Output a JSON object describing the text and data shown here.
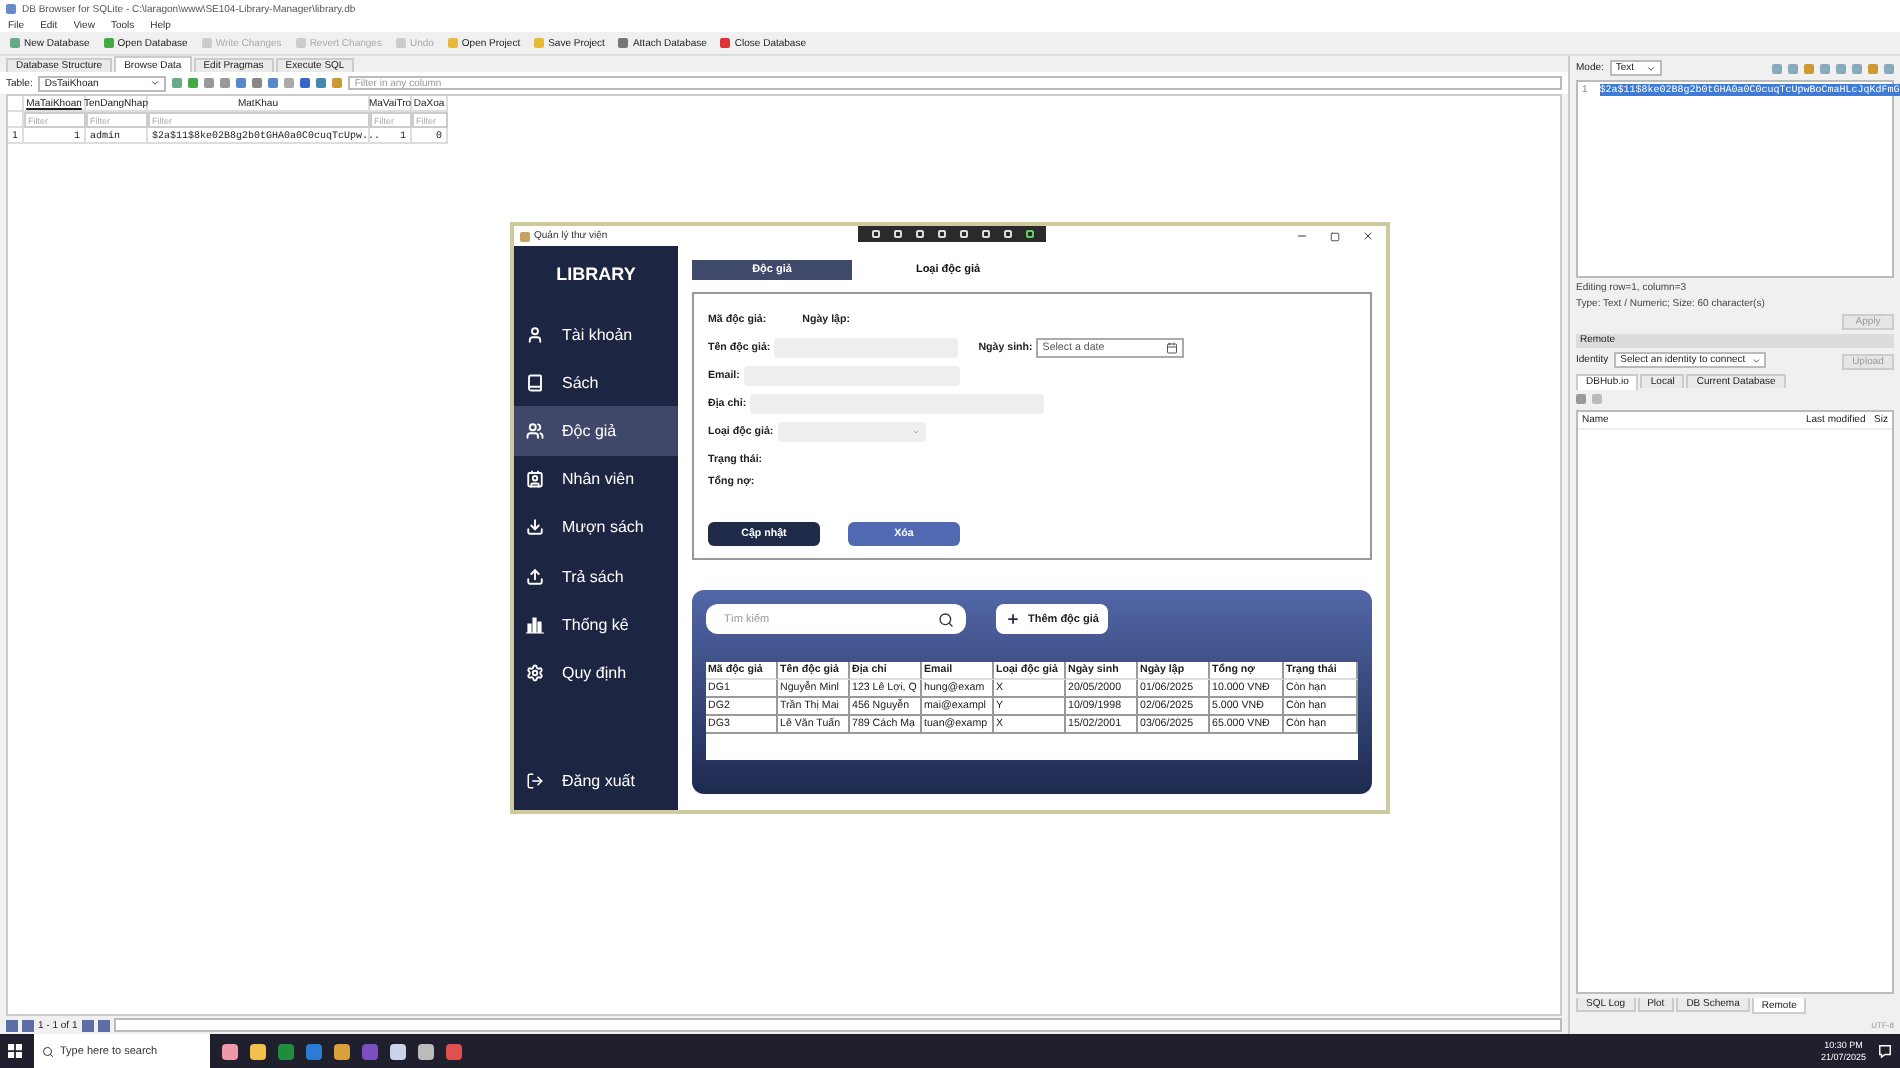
{
  "dbb": {
    "title": "DB Browser for SQLite - C:\\laragon\\www\\SE104-Library-Manager\\library.db",
    "menu": [
      "File",
      "Edit",
      "View",
      "Tools",
      "Help"
    ],
    "toolbar": [
      {
        "label": "New Database",
        "disabled": false
      },
      {
        "label": "Open Database",
        "disabled": false
      },
      {
        "label": "Write Changes",
        "disabled": true
      },
      {
        "label": "Revert Changes",
        "disabled": true
      },
      {
        "label": "Undo",
        "disabled": true
      },
      {
        "label": "Open Project",
        "disabled": false
      },
      {
        "label": "Save Project",
        "disabled": false
      },
      {
        "label": "Attach Database",
        "disabled": false
      },
      {
        "label": "Close Database",
        "disabled": false
      }
    ],
    "tabs": [
      {
        "label": "Database Structure",
        "selected": false
      },
      {
        "label": "Browse Data",
        "selected": true
      },
      {
        "label": "Edit Pragmas",
        "selected": false
      },
      {
        "label": "Execute SQL",
        "selected": false
      }
    ],
    "table_label": "Table:",
    "table_select": "DsTaiKhoan",
    "filter_placeholder": "Filter in any column",
    "grid": {
      "columns": [
        "MaTaiKhoan",
        "TenDangNhap",
        "MatKhau",
        "MaVaiTro",
        "DaXoa"
      ],
      "filter_placeholders": [
        "Filter",
        "Filter",
        "Filter",
        "Filter",
        "Filter"
      ],
      "rows": [
        {
          "row_number": "1",
          "cells": [
            "1",
            "admin",
            "$2a$11$8ke02B8g2b0tGHA0a0C0cuqTcUpw...",
            "1",
            "0"
          ]
        }
      ]
    },
    "pager": "1 - 1 of 1"
  },
  "edit_cell": {
    "mode_label": "Mode:",
    "mode": "Text",
    "line_number": "1",
    "value": "$2a$11$8ke02B8g2b0tGHA0a0C0cuqTcUpwBoCmaHLcJqKdFmG",
    "status": [
      "Editing row=1, column=3",
      "Type: Text / Numeric; Size: 60 character(s)"
    ],
    "apply": "Apply"
  },
  "remote": {
    "title": "Remote",
    "identity_label": "Identity",
    "identity_select": "Select an identity to connect",
    "upload": "Upload",
    "tabs": [
      {
        "label": "DBHub.io",
        "selected": true
      },
      {
        "label": "Local",
        "selected": false
      },
      {
        "label": "Current Database",
        "selected": false
      }
    ],
    "columns": [
      "Name",
      "Last modified",
      "Siz"
    ]
  },
  "bottom_tabs": [
    {
      "label": "SQL Log",
      "selected": false
    },
    {
      "label": "Plot",
      "selected": false
    },
    {
      "label": "DB Schema",
      "selected": false
    },
    {
      "label": "Remote",
      "selected": true
    }
  ],
  "encoding": "UTF-8",
  "app": {
    "title": "Quản lý thư viện",
    "brand": "LIBRARY",
    "sidebar": [
      {
        "label": "Tài khoản",
        "selected": false
      },
      {
        "label": "Sách",
        "selected": false
      },
      {
        "label": "Độc giả",
        "selected": true
      },
      {
        "label": "Nhân viên",
        "selected": false
      },
      {
        "label": "Mượn sách",
        "selected": false
      },
      {
        "label": "Trả sách",
        "selected": false
      },
      {
        "label": "Thống kê",
        "selected": false
      },
      {
        "label": "Quy định",
        "selected": false
      }
    ],
    "logout": "Đăng xuất",
    "tabs": [
      {
        "label": "Độc giả",
        "selected": true
      },
      {
        "label": "Loại độc giả",
        "selected": false
      }
    ],
    "form": {
      "id_label": "Mã độc giả:",
      "created_label": "Ngày lập:",
      "name_label": "Tên độc giả:",
      "birth_label": "Ngày sinh:",
      "birth_placeholder": "Select a date",
      "email_label": "Email:",
      "address_label": "Địa chỉ:",
      "type_label": "Loại độc giả:",
      "status_label": "Trạng thái:",
      "debt_label": "Tổng nợ:"
    },
    "update_button": "Cập nhật",
    "delete_button": "Xóa",
    "search_placeholder": "Tìm kiếm",
    "add_button": "Thêm độc giả",
    "table": {
      "columns": [
        "Mã độc giả",
        "Tên độc giả",
        "Địa chỉ",
        "Email",
        "Loại độc giả",
        "Ngày sinh",
        "Ngày lập",
        "Tổng nợ",
        "Trạng thái"
      ],
      "rows": [
        [
          "DG1",
          "Nguyễn Minl",
          "123 Lê Lợi, Q",
          "hung@exam",
          "X",
          "20/05/2000",
          "01/06/2025",
          "10.000 VNĐ",
          "Còn hạn"
        ],
        [
          "DG2",
          "Trần Thị Mai",
          "456 Nguyễn",
          "mai@exampl",
          "Y",
          "10/09/1998",
          "02/06/2025",
          "5.000 VNĐ",
          "Còn hạn"
        ],
        [
          "DG3",
          "Lê Văn Tuấn",
          "789 Cách Mạ",
          "tuan@examp",
          "X",
          "15/02/2001",
          "03/06/2025",
          "65.000 VNĐ",
          "Còn hạn"
        ]
      ]
    }
  },
  "taskbar": {
    "search_placeholder": "Type here to search",
    "time": "10:30 PM",
    "date": "21/07/2025"
  }
}
